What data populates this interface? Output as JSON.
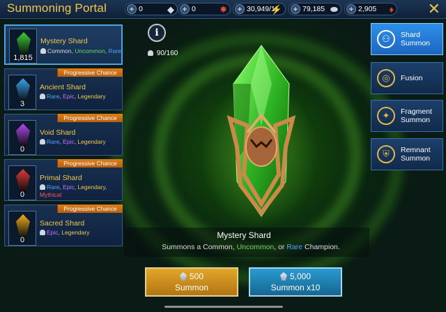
{
  "header": {
    "title": "Summoning Portal",
    "resources": [
      {
        "name": "mystery-shards",
        "value": "0",
        "icon": "shard-icon",
        "color": "#d8dde6"
      },
      {
        "name": "ancient-shards",
        "value": "0",
        "icon": "red-shard-icon",
        "color": "#e24b3b"
      },
      {
        "name": "energy",
        "value": "30,949/11",
        "icon": "lightning-icon",
        "color": "#f2d332"
      },
      {
        "name": "silver",
        "value": "79,185",
        "icon": "silver-coin-icon",
        "color": "#cfd6de"
      },
      {
        "name": "gems",
        "value": "2,905",
        "icon": "ruby-icon",
        "color": "#e0403a"
      }
    ],
    "close_label": "✕"
  },
  "shards": [
    {
      "name": "Mystery Shard",
      "count": "1,815",
      "selected": true,
      "progressive": false,
      "rarities": [
        {
          "text": "Common",
          "cls": "r-common"
        },
        {
          "text": "Uncommon",
          "cls": "r-uncommon"
        },
        {
          "text": "Rare",
          "cls": "r-rare"
        }
      ],
      "color": "#3fd13a"
    },
    {
      "name": "Ancient Shard",
      "count": "3",
      "selected": false,
      "progressive": true,
      "rarities": [
        {
          "text": "Rare",
          "cls": "r-rare"
        },
        {
          "text": "Epic",
          "cls": "r-epic"
        },
        {
          "text": "Legendary",
          "cls": "r-legendary"
        }
      ],
      "color": "#3aa6f0"
    },
    {
      "name": "Void Shard",
      "count": "0",
      "selected": false,
      "progressive": true,
      "rarities": [
        {
          "text": "Rare",
          "cls": "r-rare"
        },
        {
          "text": "Epic",
          "cls": "r-epic"
        },
        {
          "text": "Legendary",
          "cls": "r-legendary"
        }
      ],
      "color": "#b24af0"
    },
    {
      "name": "Primal Shard",
      "count": "0",
      "selected": false,
      "progressive": true,
      "rarities": [
        {
          "text": "Rare",
          "cls": "r-rare"
        },
        {
          "text": "Epic",
          "cls": "r-epic"
        },
        {
          "text": "Legendary",
          "cls": "r-legendary"
        },
        {
          "text": "Mythical",
          "cls": "r-mythical"
        }
      ],
      "color": "#e23a3a"
    },
    {
      "name": "Sacred Shard",
      "count": "0",
      "selected": false,
      "progressive": true,
      "rarities": [
        {
          "text": "Epic",
          "cls": "r-epic"
        },
        {
          "text": "Legendary",
          "cls": "r-legendary"
        }
      ],
      "color": "#f2b01e"
    }
  ],
  "progressive_label": "Progressive Chance",
  "right_menu": [
    {
      "label": "Shard Summon",
      "icon": "people-icon",
      "glyph": "⚇",
      "selected": true
    },
    {
      "label": "Fusion",
      "icon": "fusion-icon",
      "glyph": "◎",
      "selected": false
    },
    {
      "label": "Fragment Summon",
      "icon": "fragment-icon",
      "glyph": "✦",
      "selected": false
    },
    {
      "label": "Remnant Summon",
      "icon": "remnant-icon",
      "glyph": "⛨",
      "selected": false
    }
  ],
  "main": {
    "info_label": "i",
    "capacity": "90/160",
    "shard_title": "Mystery Shard",
    "desc_parts": [
      {
        "text": "Summons a Common, ",
        "cls": "r-common"
      },
      {
        "text": "Uncommon",
        "cls": "r-uncommon"
      },
      {
        "text": ", or ",
        "cls": "r-common"
      },
      {
        "text": "Rare",
        "cls": "r-rare"
      },
      {
        "text": " Champion.",
        "cls": "r-common"
      }
    ]
  },
  "summon_buttons": [
    {
      "cost": "500",
      "label": "Summon",
      "style": "gold"
    },
    {
      "cost": "5,000",
      "label": "Summon x10",
      "style": "blue"
    }
  ]
}
